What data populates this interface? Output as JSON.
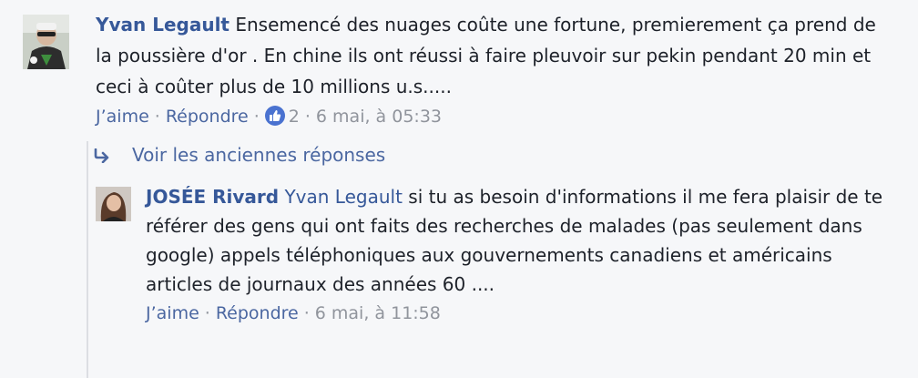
{
  "comment1": {
    "author": "Yvan Legault",
    "text": "Ensemencé des nuages coûte une fortune, premierement ça prend de la poussière d'or . En chine ils ont réussi à faire pleuvoir sur pekin pendant 20 min et ceci à coûter plus de 10 millions u.s.....",
    "like_label": "J’aime",
    "reply_label": "Répondre",
    "reaction_count": "2",
    "timestamp": "6 mai, à 05:33"
  },
  "older_replies": {
    "label": "Voir les anciennes réponses",
    "icon": "reply-arrow-icon"
  },
  "comment2": {
    "author": "JOSÉE Rivard",
    "mention": "Yvan Legault",
    "text": "si tu as besoin d'informations il me fera plaisir de te référer des gens qui ont faits des recherches de malades (pas seulement dans google) appels téléphoniques aux gouvernements canadiens et américains articles de journaux des années 60 ....",
    "like_label": "J’aime",
    "reply_label": "Répondre",
    "timestamp": "6 mai, à 11:58"
  },
  "colors": {
    "link": "#365899",
    "action_link": "#4b67a1",
    "meta": "#90949c",
    "like_badge": "#4a72d0"
  }
}
